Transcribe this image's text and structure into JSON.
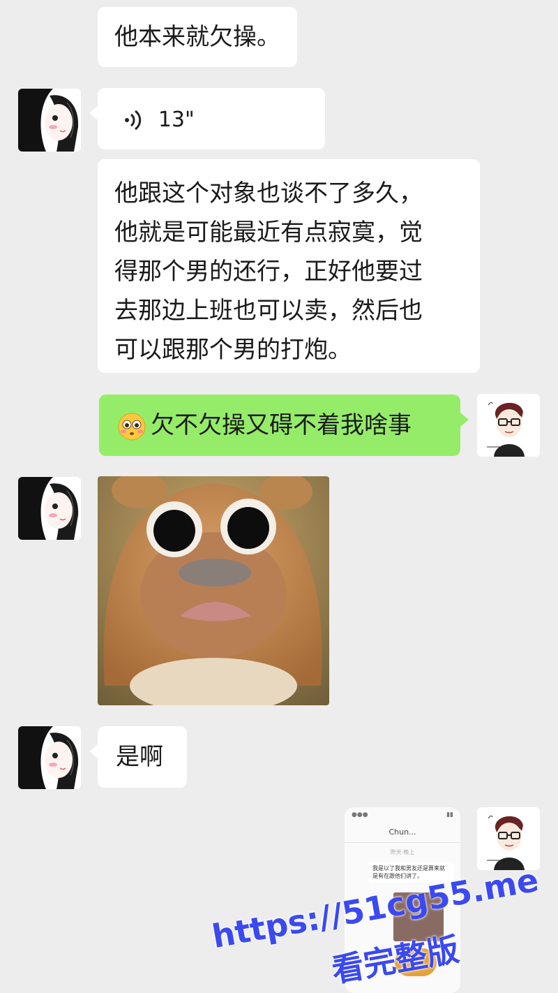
{
  "messages": {
    "m1": {
      "text": "他本来就欠操。"
    },
    "m2": {
      "voice_duration": "13\""
    },
    "m3": {
      "text": "他跟这个对象也谈不了多久，\n他就是可能最近有点寂寞，觉\n得那个男的还行，正好他要过\n去那边上班也可以卖，然后也\n可以跟那个男的打炮。"
    },
    "m4": {
      "emoji": "flushed-face",
      "text": "欠不欠操又碍不着我啥事"
    },
    "m5": {
      "sticker": "sad-bear-sticker"
    },
    "m6": {
      "text": "是啊"
    }
  },
  "screenshot": {
    "contact": "Chun...",
    "time_label": "昨天 晚上",
    "preview_text": "我是以了我和男友还是算来就是有在跟他们讲了。"
  },
  "watermark": {
    "url": "https://51cg55.me",
    "subtitle": "看完整版"
  },
  "colors": {
    "background": "#ededed",
    "received_bubble": "#ffffff",
    "sent_bubble": "#95ec69",
    "watermark": "#3b49f0"
  }
}
